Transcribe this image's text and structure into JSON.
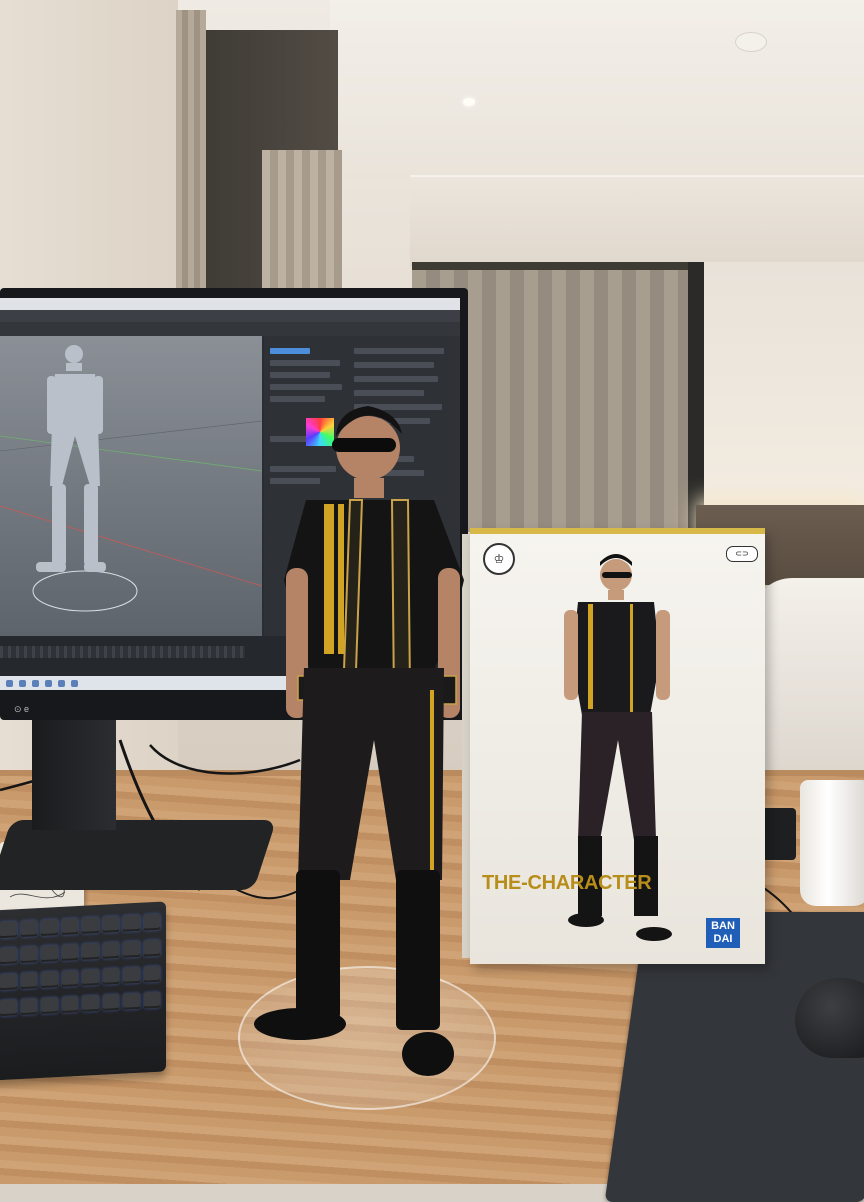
{
  "scene": {
    "description_label": "",
    "colors": {
      "desk": "#c99a6b",
      "box_gold": "#b88e1a",
      "brand_blue": "#1f5fb8",
      "jacket": "#141414",
      "stripe": "#d1a523"
    }
  },
  "box": {
    "title": "THE-CHARACTER",
    "brand_line1": "BAN",
    "brand_line2": "DAI",
    "logo_left": "♔",
    "logo_right": "⊂⊃"
  },
  "monitor": {
    "logo": "⊙ e"
  },
  "icons": {
    "mouse": "mouse-icon",
    "keyboard": "keyboard-icon",
    "mug": "mug-icon"
  }
}
